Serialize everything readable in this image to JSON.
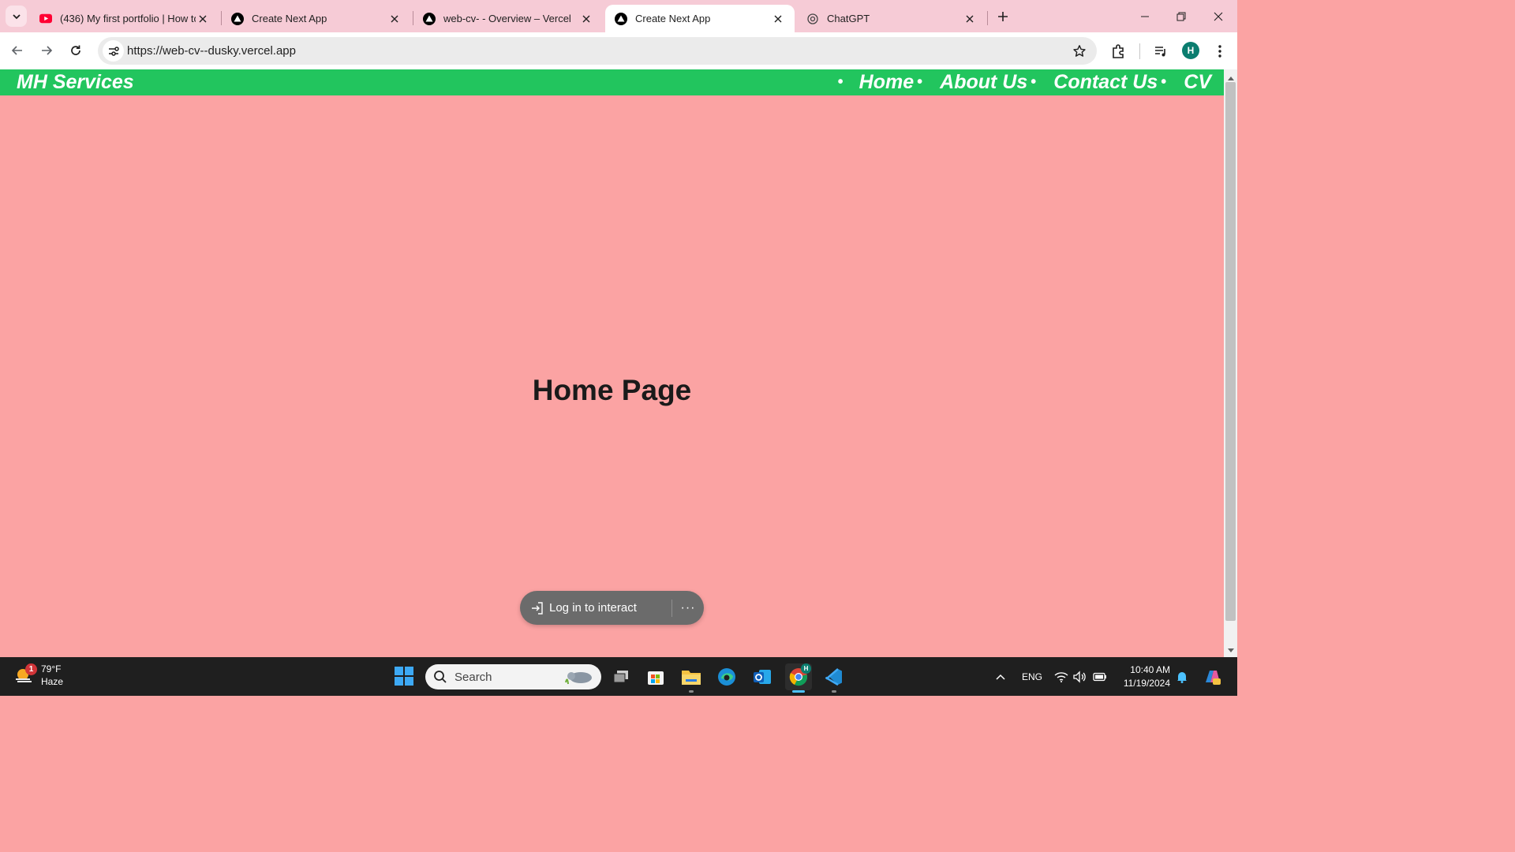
{
  "browser": {
    "tabs": [
      {
        "title": "(436) My first portfolio | How to",
        "favicon": "youtube-icon",
        "active": false
      },
      {
        "title": "Create Next App",
        "favicon": "nextjs-triangle-icon",
        "active": false
      },
      {
        "title": "web-cv- - Overview – Vercel",
        "favicon": "vercel-triangle-icon",
        "active": false
      },
      {
        "title": "Create Next App",
        "favicon": "nextjs-triangle-icon",
        "active": true
      },
      {
        "title": "ChatGPT",
        "favicon": "chatgpt-icon",
        "active": false
      }
    ],
    "url": "https://web-cv--dusky.vercel.app",
    "profile_initial": "H"
  },
  "site": {
    "brand": "MH Services",
    "nav_links": [
      "Home",
      "About Us",
      "Contact Us",
      "CV"
    ],
    "bullet": "•",
    "heading": "Home Page",
    "colors": {
      "nav": "#22c55e",
      "background": "#fba3a3",
      "heading": "#1a1a1a"
    }
  },
  "vercel_toolbar": {
    "login_label": "Log in to interact",
    "more_label": "···"
  },
  "taskbar": {
    "weather": {
      "temp": "79°F",
      "condition": "Haze",
      "badge": "1"
    },
    "search_placeholder": "Search",
    "language": "ENG",
    "time": "10:40 AM",
    "date": "11/19/2024",
    "profile_badge": "H"
  }
}
